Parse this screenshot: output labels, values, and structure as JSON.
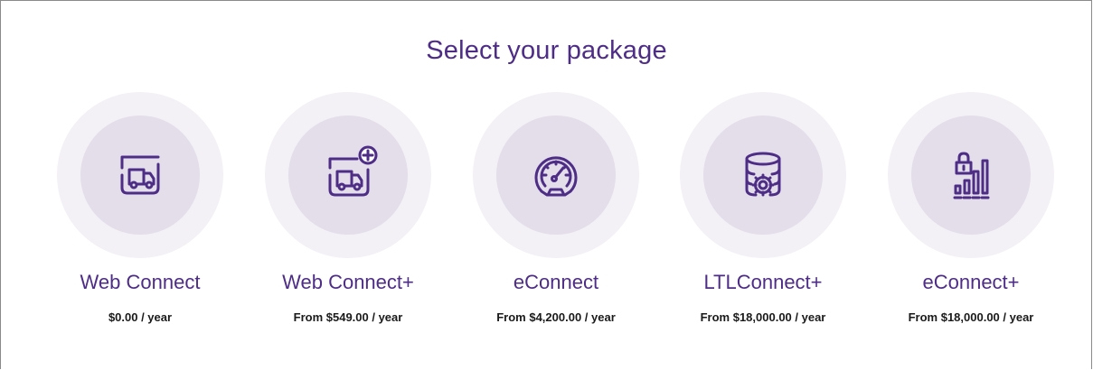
{
  "page": {
    "title": "Select your package"
  },
  "colors": {
    "accent": "#4e2d86",
    "circle_outer": "#f3f0f6",
    "circle_inner": "#e3dee9",
    "price_text": "#1a1a1a"
  },
  "packages": [
    {
      "name": "Web Connect",
      "price": "$0.00 / year",
      "icon": "truck-icon"
    },
    {
      "name": "Web Connect+",
      "price": "From $549.00 / year",
      "icon": "truck-plus-icon"
    },
    {
      "name": "eConnect",
      "price": "From $4,200.00 / year",
      "icon": "speedometer-icon"
    },
    {
      "name": "LTLConnect+",
      "price": "From $18,000.00 / year",
      "icon": "database-gear-icon"
    },
    {
      "name": "eConnect+",
      "price": "From $18,000.00 / year",
      "icon": "lock-bar-chart-icon"
    }
  ]
}
